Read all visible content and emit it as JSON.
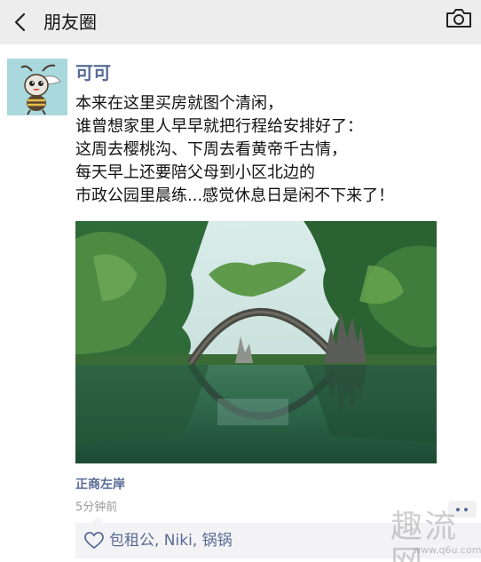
{
  "header": {
    "title": "朋友圈",
    "back_icon": "chevron-left-icon",
    "camera_icon": "camera-icon",
    "background": "#ededed"
  },
  "post": {
    "author": "可可",
    "text_lines": [
      "本来在这里买房就图个清闲，",
      "谁曾想家里人早早就把行程给安排好了：",
      "这周去樱桃沟、下周去看黄帝千古情，",
      "每天早上还要陪父母到小区北边的",
      "市政公园里晨练...感觉休息日是闲不下来了！"
    ],
    "location": "正商左岸",
    "time": "5分钟前",
    "likes": "包租公, Niki, 锅锅",
    "link_color": "#576b95"
  },
  "watermark": {
    "text": "趣流网",
    "url": "www.q6u.com"
  }
}
